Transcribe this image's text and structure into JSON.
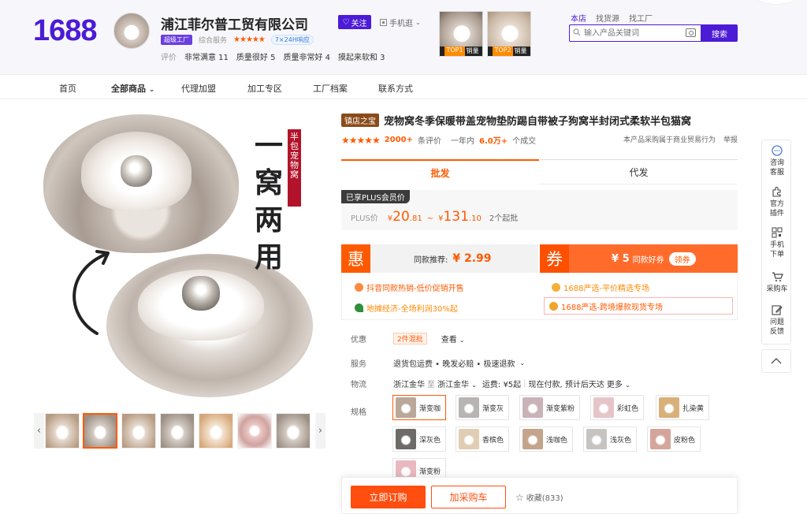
{
  "header": {
    "logo": "1688",
    "shop_name": "浦江菲尔普工贸有限公司",
    "follow_label": "关注",
    "mobile_label": "手机逛",
    "super_factory": "超级工厂",
    "overall_service_label": "综合服务",
    "service_badge": "7×24H响应",
    "rating_label": "评价",
    "ratings": [
      "非常满意 11",
      "质量很好 5",
      "质量非常好 4",
      "摸起来软和 3"
    ],
    "top_thumbs": [
      {
        "rank": "TOP1",
        "tag": "销量"
      },
      {
        "rank": "TOP2",
        "tag": "销量"
      }
    ],
    "search_tabs": [
      "本店",
      "找货源",
      "找工厂"
    ],
    "search_placeholder": "输入产品关键词",
    "search_button": "搜索"
  },
  "nav": {
    "items": [
      "首页",
      "全部商品",
      "代理加盟",
      "加工专区",
      "工厂档案",
      "联系方式"
    ]
  },
  "image": {
    "slogan": "一窝两用",
    "slogan_side": "半包宠物窝"
  },
  "product": {
    "badge": "镇店之宝",
    "title": "宠物窝冬季保暖带盖宠物垫防踢自带被子狗窝半封闭式柔软半包猫窝",
    "review_count": "2000+",
    "review_label": "条评价",
    "sales_prefix": "一年内",
    "sales_value": "6.0万+",
    "sales_suffix": "个成交",
    "trade_note": "本产品采购属于商业贸易行为",
    "report": "举报",
    "tabs": [
      "批发",
      "代发"
    ],
    "plus_badge": "已享PLUS会员价",
    "plus_label": "PLUS价",
    "price_low_int": "20",
    "price_low_dec": ".81",
    "price_high_int": "131",
    "price_high_dec": ".10",
    "currency": "¥",
    "range_sep": "~",
    "moq": "2个起批",
    "promo_hui": "惠",
    "promo_same_label": "同款推荐:",
    "promo_same_amount": "¥ 2.99",
    "promo_quan": "券",
    "coupon_amount": "¥ 5",
    "coupon_label": "同款好券",
    "coupon_claim": "领券",
    "activities": [
      "抖音同款热销-低价促销开售",
      "1688严选-平价精选专场",
      "地摊经济-全场利润30%起",
      "1688严选-跨境爆款现货专场"
    ],
    "discount_label": "优惠",
    "discount_tag": "2件混批",
    "discount_view": "查看",
    "service_label": "服务",
    "service_value": "退货包运费 • 晚发必赔 • 极速退款",
    "logistics_label": "物流",
    "ship_from": "浙江金华",
    "ship_to_word": "至",
    "ship_to": "浙江金华",
    "freight": "运费: ¥5起",
    "ship_note": "现在付款, 预计后天达",
    "more": "更多",
    "spec_label": "规格",
    "specs": [
      "渐变咖",
      "渐变灰",
      "渐变紫粉",
      "彩虹色",
      "扎染黄",
      "深灰色",
      "香槟色",
      "浅咖色",
      "浅灰色",
      "皮粉色",
      "渐变粉"
    ],
    "spec_colors": [
      "#b9a89a",
      "#b8b4b1",
      "#c9b2b8",
      "#e6c5c9",
      "#d9b07a",
      "#6e6a67",
      "#e1cdb3",
      "#c4a48a",
      "#c7c3c0",
      "#d4a59b",
      "#e9b8c0"
    ]
  },
  "bottom": {
    "order": "立即订购",
    "cart": "加采购车",
    "favorite": "收藏(833)"
  },
  "toolbar": {
    "items": [
      "咨询客服",
      "官方插件",
      "手机下单",
      "采购车",
      "问题反馈"
    ]
  }
}
